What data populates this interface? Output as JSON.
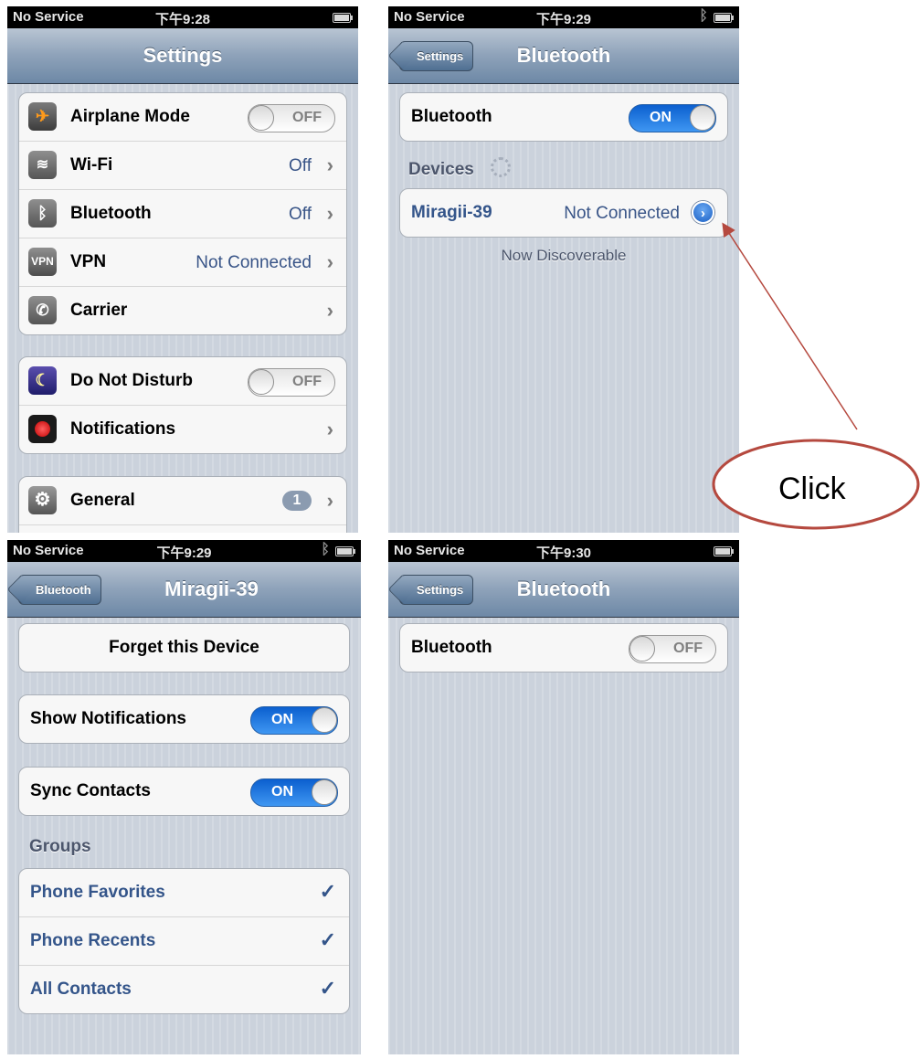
{
  "screens": {
    "settings": {
      "status": {
        "carrier": "No Service",
        "time": "下午9:28"
      },
      "nav_title": "Settings",
      "group1": [
        {
          "label": "Airplane Mode",
          "icon": "airplane-icon",
          "toggle": "OFF"
        },
        {
          "label": "Wi-Fi",
          "icon": "wifi-icon",
          "value": "Off"
        },
        {
          "label": "Bluetooth",
          "icon": "bluetooth-icon",
          "value": "Off"
        },
        {
          "label": "VPN",
          "icon": "vpn-icon",
          "icon_text": "VPN",
          "value": "Not Connected"
        },
        {
          "label": "Carrier",
          "icon": "phone-icon"
        }
      ],
      "group2": [
        {
          "label": "Do Not Disturb",
          "icon": "moon-icon",
          "toggle": "OFF"
        },
        {
          "label": "Notifications",
          "icon": "notifications-icon"
        }
      ],
      "group3": [
        {
          "label": "General",
          "icon": "gear-icon",
          "badge": "1"
        }
      ]
    },
    "bluetooth_on": {
      "status": {
        "carrier": "No Service",
        "time": "下午9:29"
      },
      "back_label": "Settings",
      "nav_title": "Bluetooth",
      "bluetooth_row": {
        "label": "Bluetooth",
        "toggle": "ON"
      },
      "devices_header": "Devices",
      "device": {
        "name": "Miragii-39",
        "status": "Not Connected"
      },
      "discoverable": "Now Discoverable"
    },
    "device_detail": {
      "status": {
        "carrier": "No Service",
        "time": "下午9:29"
      },
      "back_label": "Bluetooth",
      "nav_title": "Miragii-39",
      "forget_label": "Forget this Device",
      "show_notifications": {
        "label": "Show Notifications",
        "toggle": "ON"
      },
      "sync_contacts": {
        "label": "Sync Contacts",
        "toggle": "ON"
      },
      "groups_header": "Groups",
      "groups": [
        {
          "label": "Phone Favorites",
          "checked": true
        },
        {
          "label": "Phone Recents",
          "checked": true
        },
        {
          "label": "All Contacts",
          "checked": true
        }
      ]
    },
    "bluetooth_off": {
      "status": {
        "carrier": "No Service",
        "time": "下午9:30"
      },
      "back_label": "Settings",
      "nav_title": "Bluetooth",
      "bluetooth_row": {
        "label": "Bluetooth",
        "toggle": "OFF"
      }
    }
  },
  "annotation": {
    "label": "Click",
    "color": "#b5493f"
  },
  "glyphs": {
    "chevron": "›",
    "check": "✓",
    "bluetooth": "ᛒ",
    "airplane": "✈",
    "wifi": "≋",
    "phone": "✆",
    "moon": "☾",
    "gear": "⚙",
    "disclosure": "›"
  }
}
